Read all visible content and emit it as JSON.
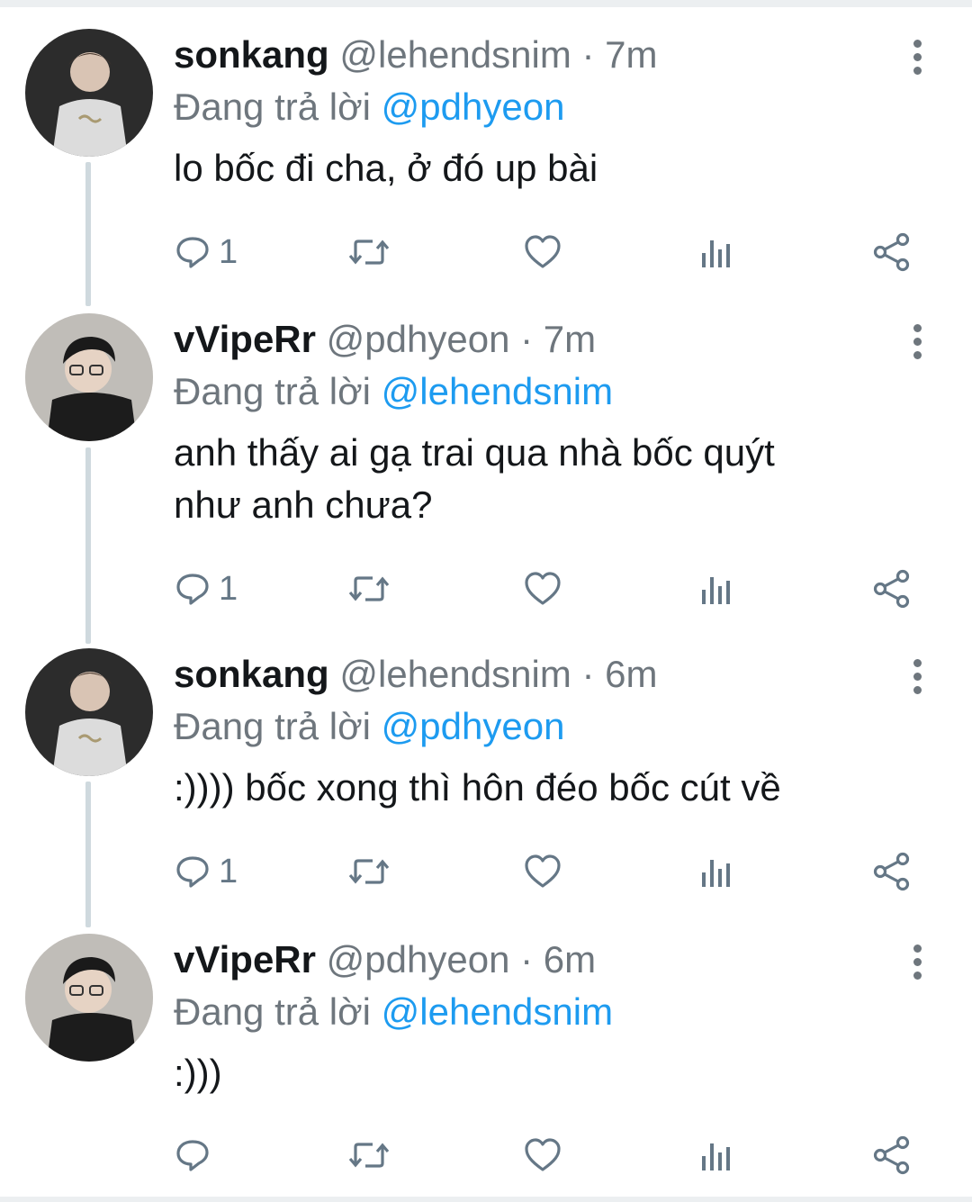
{
  "tweets": [
    {
      "name": "sonkang",
      "handle": "@lehendsnim",
      "sep": " · ",
      "time": "7m",
      "reply_prefix": "Đang trả lời ",
      "reply_to": "@pdhyeon",
      "text": "lo bốc đi cha, ở đó up bài",
      "reply_count": "1",
      "avatar": "sonkang"
    },
    {
      "name": "vVipeRr",
      "handle": "@pdhyeon",
      "sep": " · ",
      "time": "7m",
      "reply_prefix": "Đang trả lời ",
      "reply_to": "@lehendsnim",
      "text": "anh thấy ai gạ trai qua nhà bốc quýt\nnhư anh chưa?",
      "reply_count": "1",
      "avatar": "vviper"
    },
    {
      "name": "sonkang",
      "handle": "@lehendsnim",
      "sep": " · ",
      "time": "6m",
      "reply_prefix": "Đang trả lời ",
      "reply_to": "@pdhyeon",
      "text": ":)))) bốc xong thì hôn đéo bốc cút về",
      "reply_count": "1",
      "avatar": "sonkang"
    },
    {
      "name": "vVipeRr",
      "handle": "@pdhyeon",
      "sep": " · ",
      "time": "6m",
      "reply_prefix": "Đang trả lời ",
      "reply_to": "@lehendsnim",
      "text": ":)))",
      "reply_count": "",
      "avatar": "vviper"
    }
  ],
  "icons": {
    "reply": "reply-icon",
    "retweet": "retweet-icon",
    "like": "like-icon",
    "analytics": "analytics-icon",
    "share": "share-icon",
    "menu": "more-options-icon"
  },
  "colors": {
    "mention": "#1d9bf0",
    "muted": "#6e767d",
    "thread_line": "#cfd9de"
  }
}
